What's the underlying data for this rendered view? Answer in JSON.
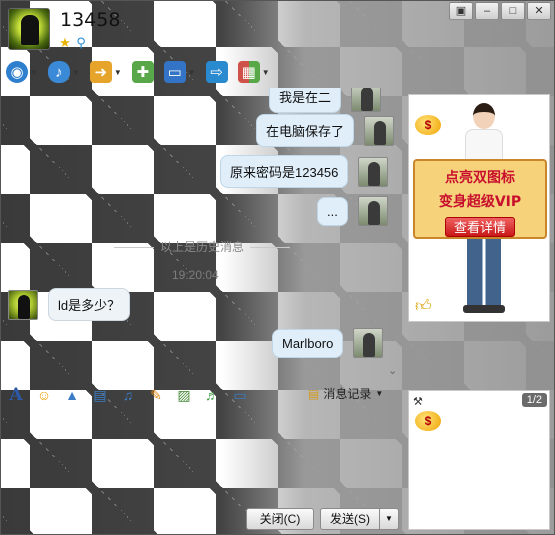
{
  "window": {
    "title": "13458",
    "controls": [
      "restore-icon",
      "minimize-icon",
      "maximize-icon",
      "close-icon"
    ]
  },
  "title_icons": [
    "star-icon",
    "wand-icon"
  ],
  "toolbar": {
    "items": [
      {
        "name": "webcam-icon",
        "color": "#2f7fcf",
        "dropdown": true
      },
      {
        "name": "microphone-icon",
        "color": "#3a8ad8",
        "dropdown": true
      },
      {
        "name": "file-transfer-icon",
        "color": "#e6a52a",
        "dropdown": true
      },
      {
        "name": "new-chat-icon",
        "color": "#58a84a",
        "dropdown": false
      },
      {
        "name": "remote-desktop-icon",
        "color": "#3474c6",
        "dropdown": true
      },
      {
        "name": "share-screen-icon",
        "color": "#2a8ad0",
        "dropdown": false
      },
      {
        "name": "apps-grid-icon",
        "color": "#d0504a",
        "dropdown": true
      }
    ]
  },
  "chat": {
    "messages_sent_before": [
      {
        "text": "我是在二"
      },
      {
        "text": "在电脑保存了"
      },
      {
        "text": "原来密码是123456"
      },
      {
        "text": "..."
      }
    ],
    "history_label": "以上是历史消息",
    "history_time": "19:20:04",
    "received": {
      "text": "ld是多少？"
    },
    "sent_after": {
      "text": "Marlboro"
    }
  },
  "format_bar": {
    "items": [
      "font-icon",
      "emoji-icon",
      "magic-icon",
      "screenshot-icon",
      "voice-icon",
      "scribble-icon",
      "image-icon",
      "music-icon",
      "remote-icon"
    ],
    "history_button": "消息记录"
  },
  "buttons": {
    "close": "关闭(C)",
    "send": "发送(S)"
  },
  "ad": {
    "line1": "点亮双图标",
    "line2": "变身超级VIP",
    "button": "查看详情"
  },
  "side_panel": {
    "pager": "1/2"
  }
}
